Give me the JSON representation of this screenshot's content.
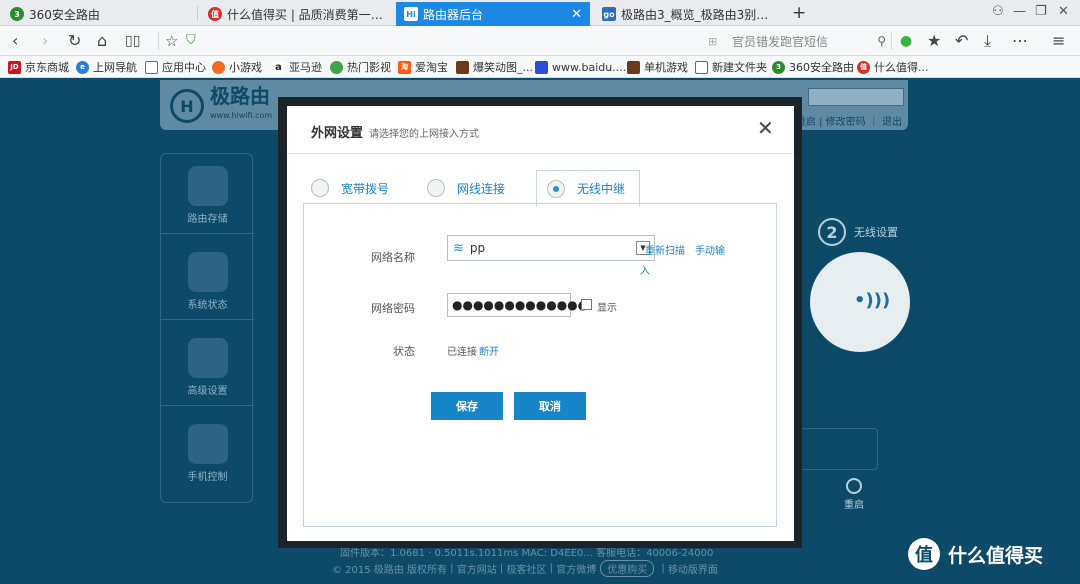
{
  "browser": {
    "tabs": [
      {
        "label": "360安全路由",
        "color": "#2a8f2a",
        "active": false
      },
      {
        "label": "什么值得买 | 品质消费第一站_网购",
        "color": "#d9302c",
        "active": false
      },
      {
        "label": "路由器后台",
        "color": "#ffffff",
        "active": true
      },
      {
        "label": "极路由3_概览_极路由3别墅级顶配",
        "color": "#2b6fb8",
        "active": false
      }
    ],
    "new_tab": "+",
    "search_placeholder": "官员错发跑官短信",
    "bookmarks": [
      {
        "label": "京东商城",
        "icon": "jd-icon"
      },
      {
        "label": "上网导航",
        "icon": "ie-icon"
      },
      {
        "label": "应用中心",
        "icon": "bag-icon"
      },
      {
        "label": "小游戏",
        "icon": "game-icon"
      },
      {
        "label": "亚马逊",
        "icon": "amazon-icon"
      },
      {
        "label": "热门影视",
        "icon": "video-icon"
      },
      {
        "label": "爱淘宝",
        "icon": "taobao-icon"
      },
      {
        "label": "爆笑动图_...",
        "icon": "fun-icon"
      },
      {
        "label": "www.baidu....",
        "icon": "baidu-icon"
      },
      {
        "label": "单机游戏",
        "icon": "pc-game-icon"
      },
      {
        "label": "新建文件夹",
        "icon": "folder-icon"
      },
      {
        "label": "360安全路由",
        "icon": "360-icon"
      },
      {
        "label": "什么值得...",
        "icon": "smzdm-icon"
      }
    ]
  },
  "router": {
    "logo_name": "极路由",
    "logo_url": "www.hiwifi.com",
    "top_links": "修改密码 ｜ 退出",
    "top_links_prefix": "重启",
    "sidebar": [
      {
        "label": "路由存储",
        "icon": "storage-icon"
      },
      {
        "label": "系统状态",
        "icon": "pulse-icon"
      },
      {
        "label": "高级设置",
        "icon": "gear-icon"
      },
      {
        "label": "手机控制",
        "icon": "phone-icon"
      }
    ],
    "wireless_step": "2",
    "wireless_label": "无线设置",
    "reboot_label": "重启",
    "footer_row1": "固件版本：1.0681 · 0.5011s.1011ms    MAC: D4EE0...    客服电话：40006-24000",
    "footer_row2": [
      "© 2015 极路由 版权所有",
      "官方网站",
      "极客社区",
      "官方微博",
      "优惠购买",
      "移动版界面"
    ]
  },
  "modal": {
    "title": "外网设置",
    "subtitle": "请选择您的上网接入方式",
    "close": "✕",
    "tabs": [
      {
        "label": "宽带拨号",
        "selected": false
      },
      {
        "label": "网线连接",
        "selected": false
      },
      {
        "label": "无线中继",
        "selected": true
      }
    ],
    "ssid_label": "网络名称",
    "ssid_value": "pp",
    "rescan": "重新扫描",
    "manual_input_1": "手动输",
    "manual_input_2": "入",
    "password_label": "网络密码",
    "password_masked": "●●●●●●●●●●●●●",
    "show_password": "显示",
    "status_label": "状态",
    "status_value": "已连接",
    "disconnect": "断开",
    "save": "保存",
    "cancel": "取消"
  },
  "watermark": {
    "text": "什么值得买",
    "icon": "值"
  },
  "colors": {
    "primary": "#1786c8",
    "page_bg": "#0d4a69",
    "active_tab": "#1e88e5"
  }
}
